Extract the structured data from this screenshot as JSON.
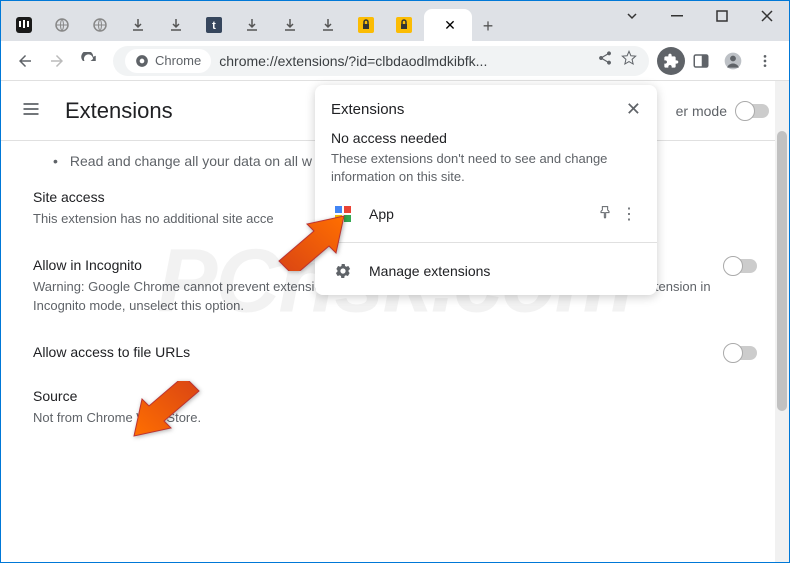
{
  "tabs": {
    "count": 12
  },
  "omnibox": {
    "chip": "Chrome",
    "url": "chrome://extensions/?id=clbdaodlmdkibfk..."
  },
  "page": {
    "title": "Extensions",
    "dev_mode_label": "er mode"
  },
  "content": {
    "bullet": "Read and change all your data on all w",
    "site_access": {
      "title": "Site access",
      "body": "This extension has no additional site acce"
    },
    "incognito": {
      "title": "Allow in Incognito",
      "body": "Warning: Google Chrome cannot prevent extensions from recording your browsing history. To disable this extension in Incognito mode, unselect this option."
    },
    "file_urls": {
      "title": "Allow access to file URLs"
    },
    "source": {
      "title": "Source",
      "body": "Not from Chrome Web Store."
    }
  },
  "popup": {
    "title": "Extensions",
    "sub_title": "No access needed",
    "sub_desc": "These extensions don't need to see and change information on this site.",
    "app_label": "App",
    "manage_label": "Manage extensions"
  },
  "watermark": "PCrisk.com"
}
